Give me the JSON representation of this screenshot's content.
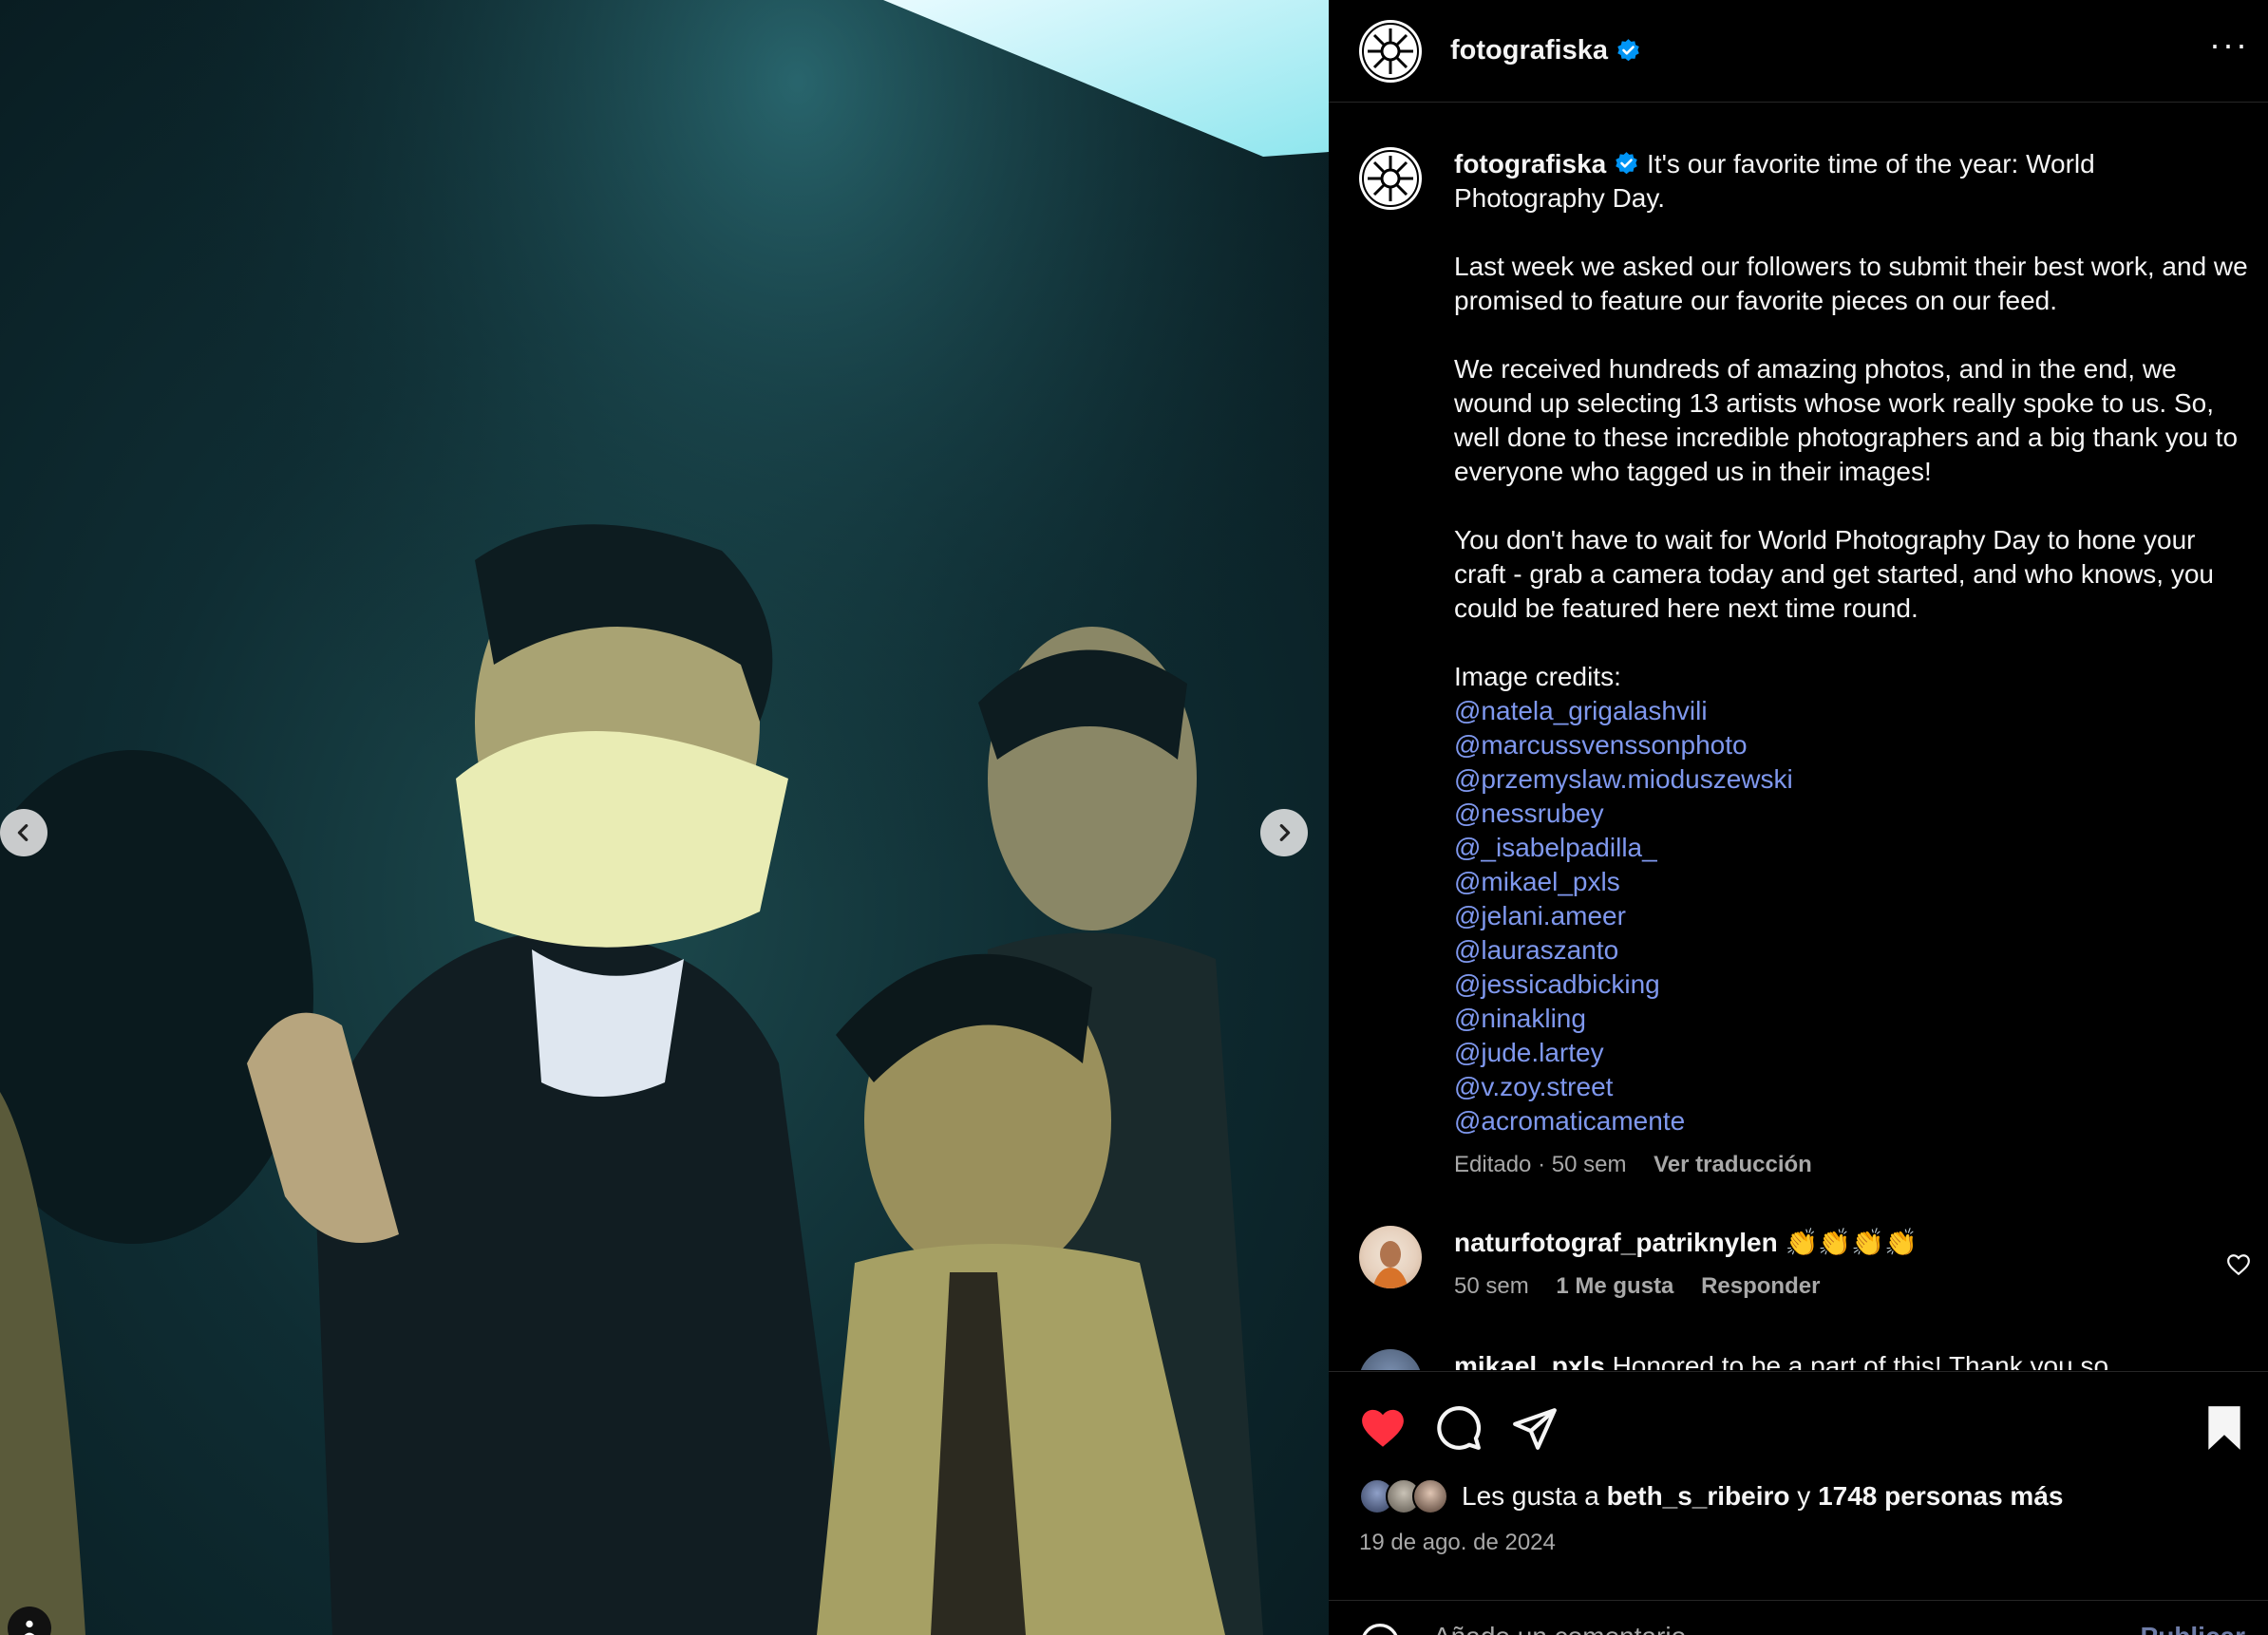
{
  "post": {
    "username": "fotografiska",
    "more_icon": "more-horizontal-icon",
    "verified_color": "#0095f6"
  },
  "caption": {
    "username": "fotografiska",
    "first_line": "It's our favorite time of the year: World Photography Day.",
    "paragraphs": [
      "Last week we asked our followers to submit their best work, and we promised to feature our favorite pieces on our feed.",
      "We received hundreds of amazing photos, and in the end, we wound up selecting 13 artists whose work really spoke to us. So, well done to these incredible photographers and a big thank you to everyone who tagged us in their images!",
      "You don't have to wait for World Photography Day to hone your craft - grab a camera today and get started, and who knows, you could be featured here next time round."
    ],
    "credits_title": "Image credits:",
    "mentions": [
      "@natela_grigalashvili",
      "@marcussvenssonphoto",
      "@przemyslaw.mioduszewski",
      "@nessrubey",
      "@_isabelpadilla_",
      "@mikael_pxls",
      "@jelani.ameer",
      "@lauraszanto",
      "@jessicadbicking",
      "@ninakling",
      "@jude.lartey",
      "@v.zoy.street",
      "@acromaticamente"
    ],
    "meta": "Editado · 50 sem",
    "translate": "Ver traducción"
  },
  "comments": [
    {
      "username": "naturfotograf_patriknylen",
      "text": "👏👏👏👏",
      "time": "50 sem",
      "likes": "1 Me gusta",
      "reply": "Responder"
    },
    {
      "username": "mikael_pxls",
      "text": "Honored to be a part of this! Thank you so"
    }
  ],
  "actions": {
    "like_color": "#ff3040",
    "likes_prefix": "Les gusta a",
    "liked_by": "beth_s_ribeiro",
    "conjunction": "y",
    "others": "1748 personas más",
    "date": "19 de ago. de 2024"
  },
  "comment_box": {
    "placeholder": "Añade un comentario...",
    "publish": "Publicar"
  },
  "media": {
    "prev_icon": "chevron-left-icon",
    "next_icon": "chevron-right-icon",
    "tag_icon": "user-tag-icon"
  },
  "colors": {
    "mention": "#7f98ee",
    "secondary_text": "#a8a8a8",
    "background": "#000000"
  }
}
